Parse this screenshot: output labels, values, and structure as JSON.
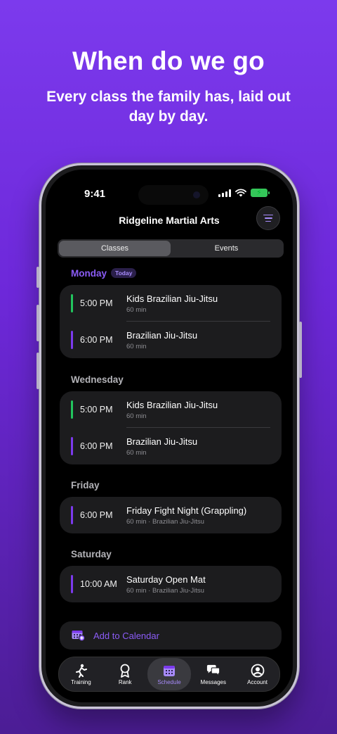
{
  "promo": {
    "headline": "When do we go",
    "subline": "Every class the family has, laid out day by day."
  },
  "status": {
    "time": "9:41"
  },
  "app": {
    "title": "Ridgeline Martial Arts",
    "segments": [
      "Classes",
      "Events"
    ],
    "selected_segment": "Classes"
  },
  "colors": {
    "accent": "#8b5cf6",
    "kids": "#22c55e",
    "adult": "#7c3aed"
  },
  "schedule": [
    {
      "day": "Monday",
      "badge": "Today",
      "classes": [
        {
          "time": "5:00 PM",
          "name": "Kids Brazilian Jiu-Jitsu",
          "meta": "60 min",
          "color": "#22c55e"
        },
        {
          "time": "6:00 PM",
          "name": "Brazilian Jiu-Jitsu",
          "meta": "60 min",
          "color": "#7c3aed"
        }
      ]
    },
    {
      "day": "Wednesday",
      "classes": [
        {
          "time": "5:00 PM",
          "name": "Kids Brazilian Jiu-Jitsu",
          "meta": "60 min",
          "color": "#22c55e"
        },
        {
          "time": "6:00 PM",
          "name": "Brazilian Jiu-Jitsu",
          "meta": "60 min",
          "color": "#7c3aed"
        }
      ]
    },
    {
      "day": "Friday",
      "classes": [
        {
          "time": "6:00 PM",
          "name": "Friday Fight Night (Grappling)",
          "meta": "60 min · Brazilian Jiu-Jitsu",
          "color": "#7c3aed"
        }
      ]
    },
    {
      "day": "Saturday",
      "classes": [
        {
          "time": "10:00 AM",
          "name": "Saturday Open Mat",
          "meta": "60 min · Brazilian Jiu-Jitsu",
          "color": "#7c3aed"
        }
      ]
    }
  ],
  "add_calendar": {
    "label": "Add to Calendar",
    "icon": "calendar-add-icon"
  },
  "tabs": [
    {
      "label": "Training",
      "icon": "training-icon"
    },
    {
      "label": "Rank",
      "icon": "rank-icon"
    },
    {
      "label": "Schedule",
      "icon": "schedule-icon",
      "active": true
    },
    {
      "label": "Messages",
      "icon": "messages-icon"
    },
    {
      "label": "Account",
      "icon": "account-icon"
    }
  ]
}
